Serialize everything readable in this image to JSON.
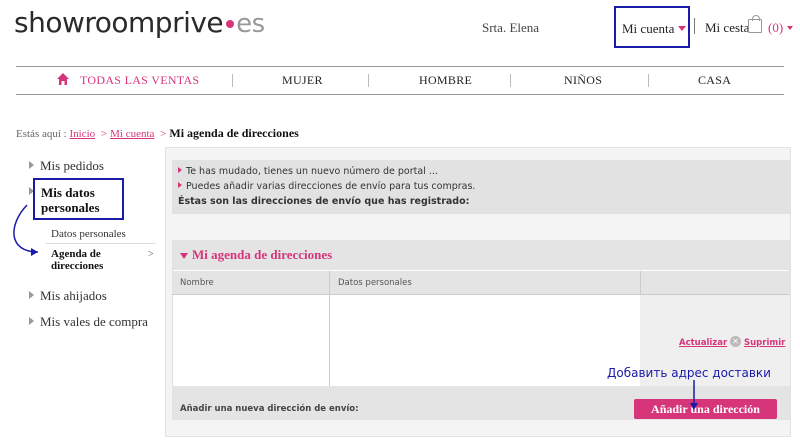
{
  "header": {
    "logo_main": "showroomprive",
    "logo_tld": "es",
    "greeting": "Srta.  Elena",
    "account_label": "Mi cuenta",
    "cart_label": "Mi cesta",
    "cart_count": "(0)"
  },
  "nav": {
    "items": [
      "TODAS LAS VENTAS",
      "MUJER",
      "HOMBRE",
      "NIÑOS",
      "CASA"
    ]
  },
  "breadcrumb": {
    "prefix": "Estás aquí :",
    "home": "Inicio",
    "account": "Mi cuenta",
    "current": "Mi agenda de direcciones"
  },
  "sidebar": {
    "pedidos": "Mis pedidos",
    "datos_1": "Mis datos",
    "datos_2": "personales",
    "sub_datos": "Datos personales",
    "sub_agenda_1": "Agenda de",
    "sub_agenda_2": "direcciones",
    "ahijados": "Mis ahijados",
    "vales": "Mis vales de compra"
  },
  "info": {
    "line1": "Te has mudado, tienes un nuevo número de portal ...",
    "line2": "Puedes añadir varias direcciones de envío para tus compras.",
    "line3": "Éstas son las direcciones de envío que has registrado:"
  },
  "agenda": {
    "title": "Mi agenda de direcciones",
    "col_nombre": "Nombre",
    "col_datos": "Datos personales",
    "update_link": "Actualizar",
    "delete_link": "Suprimir",
    "add_label": "Añadir una nueva dirección de envío:",
    "add_button": "Añadir una dirección"
  },
  "annotation": {
    "text": "Добавить адрес доставки"
  },
  "colors": {
    "accent": "#d6357a",
    "annotation": "#1a1aa8"
  }
}
